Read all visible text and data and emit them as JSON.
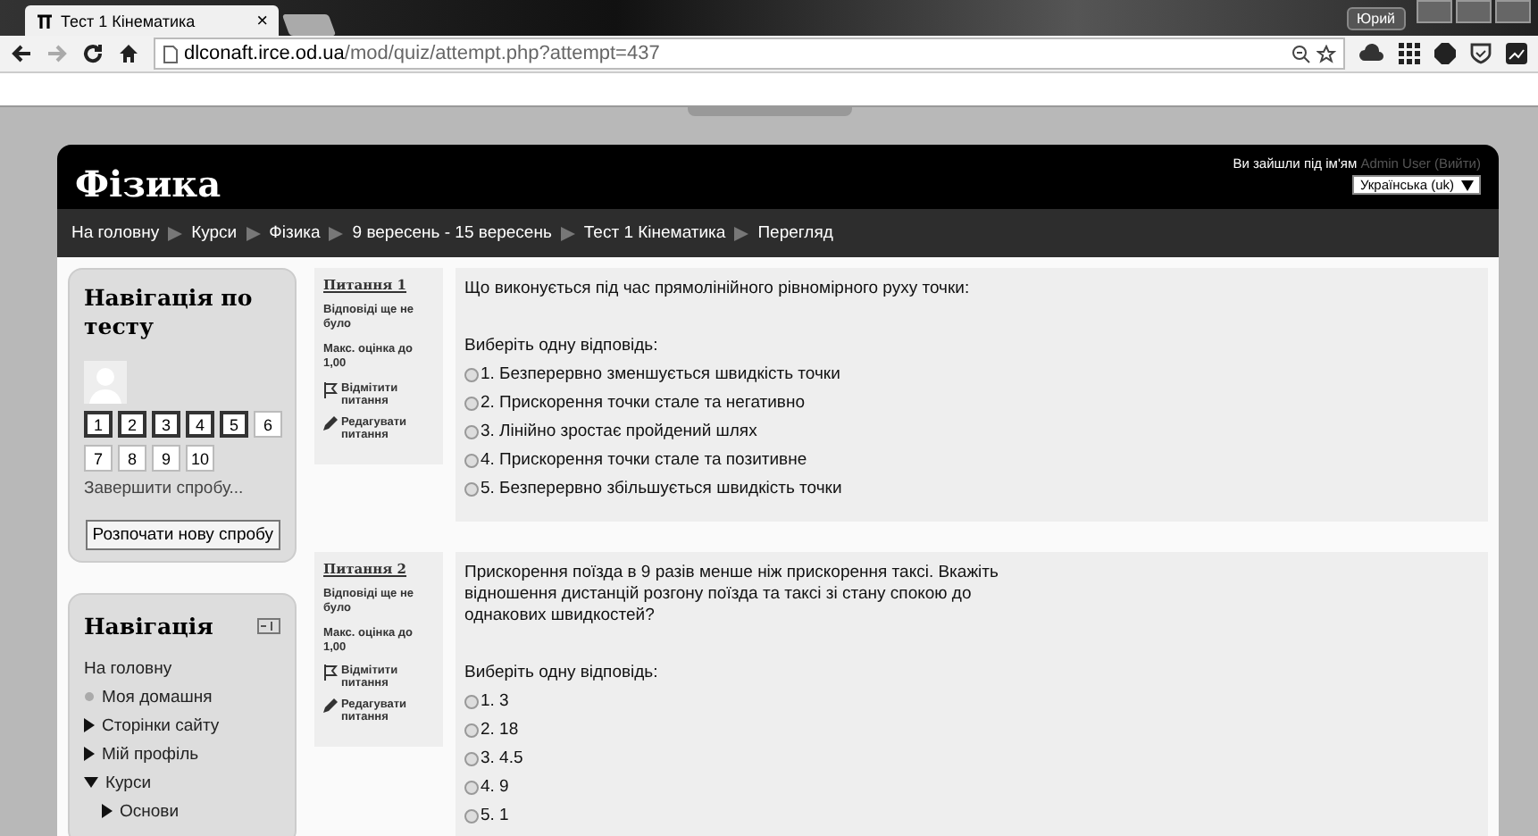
{
  "browser": {
    "tab_title": "Тест 1 Кінематика",
    "tab_close": "×",
    "url_host": "dlconaft.irce.od.ua",
    "url_path": "/mod/quiz/attempt.php?attempt=437",
    "user_button": "Юрий"
  },
  "header": {
    "site_title": "Фізика",
    "login_prefix": "Ви зайшли під ім'ям",
    "user_link": "Admin User",
    "logout_link": "(Вийти)",
    "language": "Українська (uk)"
  },
  "breadcrumb": [
    {
      "label": "На головну"
    },
    {
      "label": "Курси"
    },
    {
      "label": "Фізика"
    },
    {
      "label": "9 вересень - 15 вересень"
    },
    {
      "label": "Тест 1 Кінематика"
    },
    {
      "label": "Перегляд"
    }
  ],
  "quiz_nav": {
    "title": "Навігація по тесту",
    "buttons": [
      {
        "label": "1",
        "current": true
      },
      {
        "label": "2",
        "current": true
      },
      {
        "label": "3",
        "current": true
      },
      {
        "label": "4",
        "current": true
      },
      {
        "label": "5",
        "current": true
      },
      {
        "label": "6",
        "current": false
      },
      {
        "label": "7",
        "current": false
      },
      {
        "label": "8",
        "current": false
      },
      {
        "label": "9",
        "current": false
      },
      {
        "label": "10",
        "current": false
      }
    ],
    "finish_link": "Завершити спробу...",
    "restart_button": "Розпочати нову спробу"
  },
  "navigation": {
    "title": "Навігація",
    "items": [
      {
        "label": "На головну",
        "kind": "link"
      },
      {
        "label": "Моя домашня",
        "kind": "leaf"
      },
      {
        "label": "Сторінки сайту",
        "kind": "branch",
        "expanded": false
      },
      {
        "label": "Мій профіль",
        "kind": "branch",
        "expanded": false
      },
      {
        "label": "Курси",
        "kind": "branch",
        "expanded": true,
        "children": [
          {
            "label": "Основи",
            "kind": "branch",
            "expanded": false
          }
        ]
      }
    ]
  },
  "questions": [
    {
      "number": "Питання 1",
      "status": "Відповіді ще не було",
      "mark": "Макс. оцінка до 1,00",
      "flag": "Відмітити питання",
      "edit": "Редагувати питання",
      "text": "Що виконується під час  прямолінійного рівномірного руху точки:",
      "prompt": "Виберіть одну відповідь:",
      "answers": [
        {
          "label": "1. Безперервно зменшується швидкість точки",
          "selected": false
        },
        {
          "label": "2. Прискорення точки стале та негативно",
          "selected": false
        },
        {
          "label": "3. Лінійно зростає пройдений шлях",
          "selected": false
        },
        {
          "label": "4. Прискорення точки стале та позитивне",
          "selected": false
        },
        {
          "label": "5. Безперервно збільшується швидкість точки",
          "selected": false
        }
      ]
    },
    {
      "number": "Питання 2",
      "status": "Відповіді ще не було",
      "mark": "Макс. оцінка до 1,00",
      "flag": "Відмітити питання",
      "edit": "Редагувати питання",
      "text": "Прискорення поїзда в 9 разів менше ніж прискорення таксі. Вкажіть відношення дистанцій розгону поїзда та таксі зі стану спокою до однакових швидкостей?",
      "prompt": "Виберіть одну відповідь:",
      "answers": [
        {
          "label": "1. 3",
          "selected": false
        },
        {
          "label": "2. 18",
          "selected": false
        },
        {
          "label": "3. 4.5",
          "selected": false
        },
        {
          "label": "4. 9",
          "selected": false
        },
        {
          "label": "5. 1",
          "selected": false
        }
      ]
    }
  ]
}
